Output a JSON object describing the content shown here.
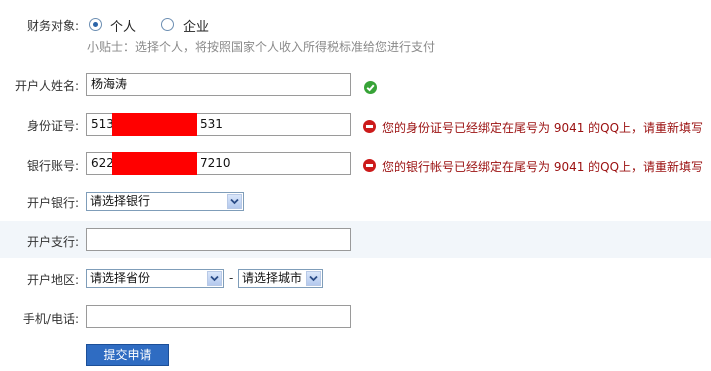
{
  "form": {
    "target": {
      "label": "财务对象:",
      "option_person": "个人",
      "option_company": "企业",
      "selected": "个人",
      "tip": "小贴士：选择个人，将按照国家个人收入所得税标准给您进行支付"
    },
    "account_name": {
      "label": "开户人姓名:",
      "value": "杨海涛",
      "status": "valid"
    },
    "id_number": {
      "label": "身份证号:",
      "value_prefix": "513",
      "value_suffix": "531",
      "error": "您的身份证号已经绑定在尾号为  9041 的QQ上，请重新填写"
    },
    "bank_account": {
      "label": "银行账号:",
      "value_prefix": "622",
      "value_suffix": "7210",
      "error": "您的银行帐号已经绑定在尾号为  9041 的QQ上，请重新填写"
    },
    "bank": {
      "label": "开户银行:",
      "selected": "请选择银行"
    },
    "branch": {
      "label": "开户支行:",
      "value": ""
    },
    "region": {
      "label": "开户地区:",
      "province_selected": "请选择省份",
      "separator": "-",
      "city_selected": "请选择城市"
    },
    "phone": {
      "label": "手机/电话:",
      "value": ""
    },
    "submit_label": "提交申请"
  },
  "colors": {
    "error_text": "#9a0f0f",
    "submit_bg": "#2f6cc2",
    "mask_red": "#ff0000",
    "ok_green": "#37a337",
    "band_bg": "#f2f6fa"
  },
  "icons": {
    "valid": "check-circle-icon",
    "error": "minus-circle-icon",
    "dropdown": "chevron-down-icon"
  }
}
